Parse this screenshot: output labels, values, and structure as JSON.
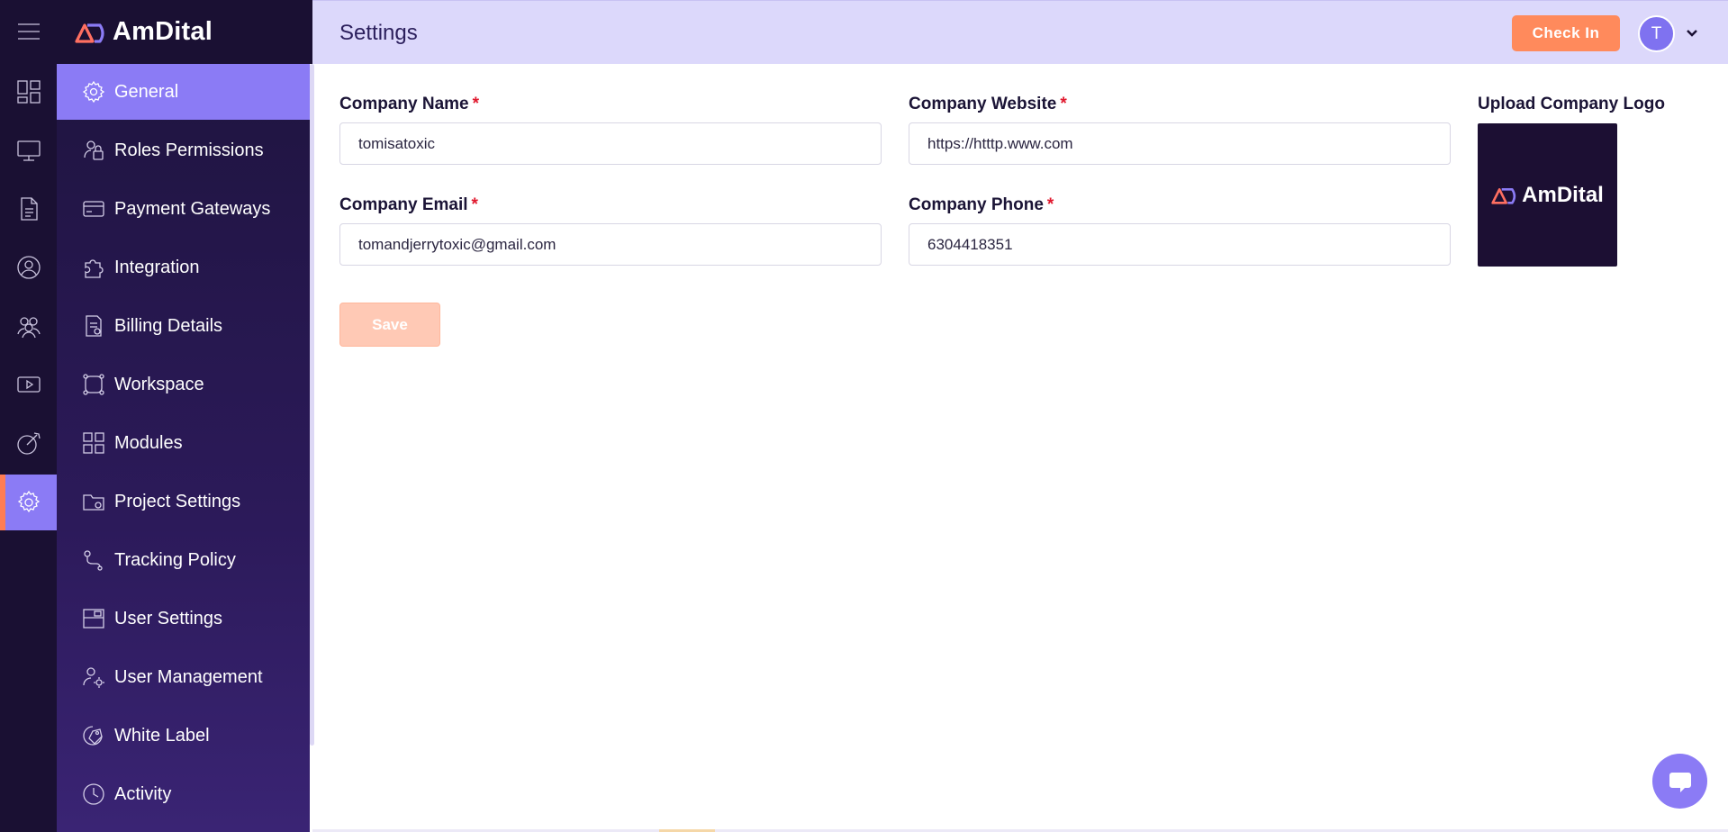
{
  "brand": {
    "name": "AmDital",
    "accent": "#ff7d55",
    "primary": "#8b7bf5"
  },
  "header": {
    "title": "Settings",
    "checkin_label": "Check In",
    "avatar_initial": "T"
  },
  "rail": {
    "items": [
      {
        "icon": "menu-icon"
      },
      {
        "icon": "dashboard-icon"
      },
      {
        "icon": "monitor-icon"
      },
      {
        "icon": "document-icon"
      },
      {
        "icon": "user-circle-icon"
      },
      {
        "icon": "team-icon"
      },
      {
        "icon": "video-icon"
      },
      {
        "icon": "goal-icon"
      },
      {
        "icon": "gear-icon",
        "active": true
      }
    ]
  },
  "sidebar": {
    "items": [
      {
        "label": "General",
        "icon": "gear-icon",
        "active": true
      },
      {
        "label": "Roles Permissions",
        "icon": "lock-user-icon"
      },
      {
        "label": "Payment Gateways",
        "icon": "card-icon"
      },
      {
        "label": "Integration",
        "icon": "puzzle-icon"
      },
      {
        "label": "Billing Details",
        "icon": "invoice-icon"
      },
      {
        "label": "Workspace",
        "icon": "workspace-icon"
      },
      {
        "label": "Modules",
        "icon": "grid-icon"
      },
      {
        "label": "Project Settings",
        "icon": "folder-gear-icon"
      },
      {
        "label": "Tracking Policy",
        "icon": "route-icon"
      },
      {
        "label": "User Settings",
        "icon": "window-icon"
      },
      {
        "label": "User Management",
        "icon": "user-gear-icon"
      },
      {
        "label": "White Label",
        "icon": "tag-icon"
      },
      {
        "label": "Activity",
        "icon": "clock-icon"
      }
    ]
  },
  "form": {
    "company_name": {
      "label": "Company Name",
      "required": "*",
      "value": "tomisatoxic"
    },
    "company_website": {
      "label": "Company Website",
      "required": "*",
      "value": "https://htttp.www.com"
    },
    "company_email": {
      "label": "Company Email",
      "required": "*",
      "value": "tomandjerrytoxic@gmail.com"
    },
    "company_phone": {
      "label": "Company Phone",
      "required": "*",
      "value": "6304418351"
    },
    "logo": {
      "label": "Upload Company Logo",
      "preview_text": "AmDital"
    },
    "save_label": "Save"
  },
  "chat": {
    "icon": "chat-icon"
  }
}
